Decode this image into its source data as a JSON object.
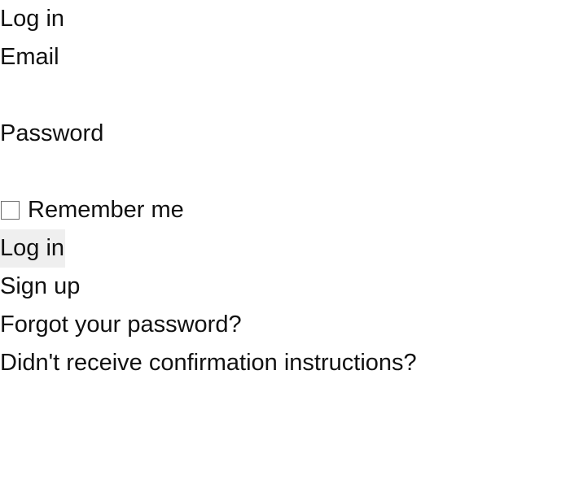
{
  "form": {
    "title": "Log in",
    "email_label": "Email",
    "email_value": "",
    "password_label": "Password",
    "password_value": "",
    "remember_label": "Remember me",
    "remember_checked": false,
    "submit_label": "Log in"
  },
  "links": {
    "sign_up": "Sign up",
    "forgot_password": "Forgot your password?",
    "confirmation": "Didn't receive confirmation instructions?"
  }
}
